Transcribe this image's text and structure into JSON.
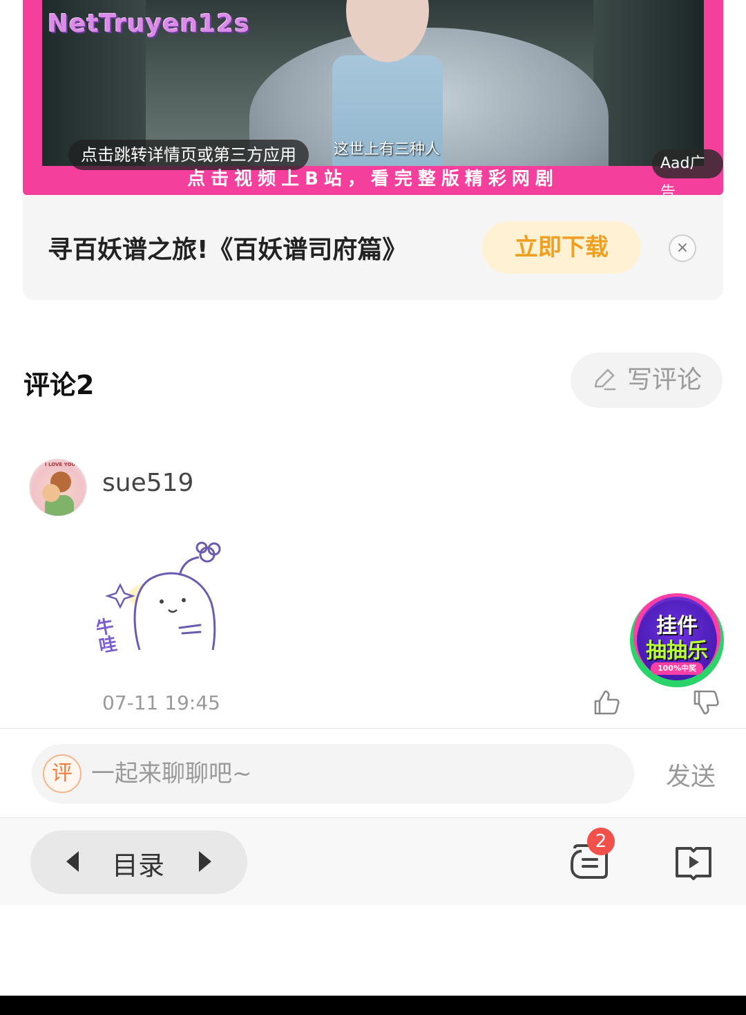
{
  "ad_video": {
    "watermark": "NetTruyen12s",
    "subtitle": "这世上有三种人",
    "jump_label": "点击跳转详情页或第三方应用",
    "ad_tag": "Aad广告",
    "bili_line": "点击视频上B站，看完整版精彩网剧"
  },
  "ad_info": {
    "title": "寻百妖谱之旅!《百妖谱司府篇》",
    "download_label": "立即下载",
    "close_symbol": "×"
  },
  "comments": {
    "title": "评论2",
    "write_label": "写评论",
    "items": [
      {
        "username": "sue519",
        "avatar_tag": "I LOVE YOU",
        "sticker_text": "牛哇",
        "time": "07-11 19:45"
      }
    ]
  },
  "float_badge": {
    "line1": "挂件",
    "line2": "抽抽乐",
    "line3": "100%中奖"
  },
  "input": {
    "icon_label": "评",
    "placeholder": "一起来聊聊吧~",
    "send_label": "发送"
  },
  "bottom_nav": {
    "toc_label": "目录",
    "comment_badge": "2"
  },
  "colors": {
    "ad_frame": "#f43f9c",
    "download_text": "#f0a020",
    "download_bg": "#fff1d4",
    "badge": "#f2504a"
  }
}
